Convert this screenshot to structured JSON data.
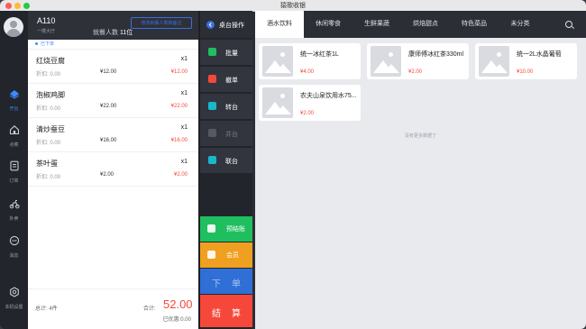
{
  "window": {
    "title": "猿歌收银"
  },
  "sidebar": {
    "items": [
      {
        "label": "开台",
        "icon": "table-icon",
        "active": true
      },
      {
        "label": "点菜",
        "icon": "home-icon",
        "active": false
      },
      {
        "label": "订单",
        "icon": "document-icon",
        "active": false
      },
      {
        "label": "外卖",
        "icon": "scooter-icon",
        "active": false
      },
      {
        "label": "消息",
        "icon": "chat-icon",
        "active": false
      },
      {
        "label": "本机设置",
        "icon": "gear-icon",
        "active": false
      }
    ]
  },
  "order": {
    "table_no": "A110",
    "area": "一楼大厅",
    "guests_label": "就餐人数",
    "guests_value": "11位",
    "head_button": "修改就餐人数和备注",
    "sent_label": "已下单",
    "items": [
      {
        "name": "红烧豆腐",
        "qty": "x1",
        "discount": "折扣: 0.00",
        "price": "¥12.00",
        "total": "¥12.00"
      },
      {
        "name": "泡椒鸡脚",
        "qty": "x1",
        "discount": "折扣: 0.00",
        "price": "¥22.00",
        "total": "¥22.00"
      },
      {
        "name": "清炒蚕豆",
        "qty": "x1",
        "discount": "折扣: 0.00",
        "price": "¥16.00",
        "total": "¥16.00"
      },
      {
        "name": "茶叶蛋",
        "qty": "x1",
        "discount": "折扣: 0.00",
        "price": "¥2.00",
        "total": "¥2.00"
      }
    ],
    "footer": {
      "count": "总计: 4件",
      "sum_label": "合计:",
      "sum": "52.00",
      "discount": "已优惠:0.00"
    }
  },
  "actions": {
    "header": "桌台操作",
    "buttons": [
      {
        "label": "批量",
        "color": "#1fbf5f",
        "enabled": true
      },
      {
        "label": "撤单",
        "color": "#f5483a",
        "enabled": true
      },
      {
        "label": "转台",
        "color": "#18b7c9",
        "enabled": true
      },
      {
        "label": "并台",
        "color": "#555963",
        "enabled": false
      },
      {
        "label": "联台",
        "color": "#18b7c9",
        "enabled": true
      }
    ],
    "big": [
      {
        "label": "预结账",
        "color": "#1fbf5f"
      },
      {
        "label": "会员",
        "color": "#f0a020"
      },
      {
        "label": "下单",
        "color": "#2f6fd6"
      },
      {
        "label": "结算",
        "color": "#f5483a"
      }
    ]
  },
  "menu": {
    "tabs": [
      "酒水饮料",
      "休闲零食",
      "生鲜果蔬",
      "烘焙甜点",
      "特色菜品",
      "未分类"
    ],
    "active_tab": 0,
    "products": [
      {
        "name": "统一冰红茶1L",
        "price": "¥4.00"
      },
      {
        "name": "康师傅冰红茶330ml",
        "price": "¥2.00"
      },
      {
        "name": "统一2L水晶葡萄",
        "price": "¥10.00"
      },
      {
        "name": "农夫山泉饮用水75...",
        "price": "¥2.00"
      }
    ],
    "no_more": "没有更多数据了"
  }
}
